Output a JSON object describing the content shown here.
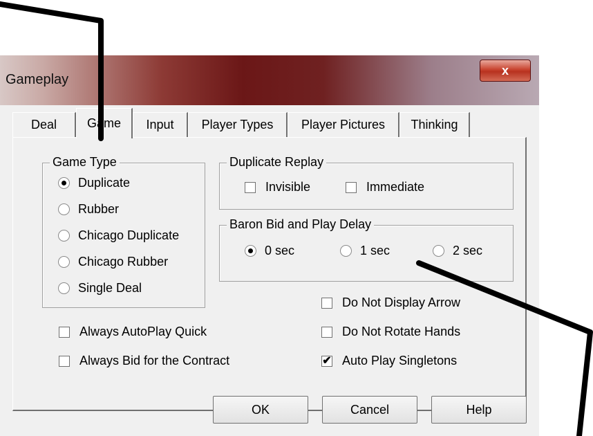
{
  "window": {
    "title": "Gameplay",
    "close_symbol": "x"
  },
  "tabs": [
    {
      "label": "Deal"
    },
    {
      "label": "Game",
      "active": true
    },
    {
      "label": "Input"
    },
    {
      "label": "Player Types"
    },
    {
      "label": "Player Pictures"
    },
    {
      "label": "Thinking"
    }
  ],
  "game_type": {
    "title": "Game Type",
    "options": [
      {
        "label": "Duplicate",
        "selected": true
      },
      {
        "label": "Rubber",
        "selected": false
      },
      {
        "label": "Chicago Duplicate",
        "selected": false
      },
      {
        "label": "Chicago Rubber",
        "selected": false
      },
      {
        "label": "Single Deal",
        "selected": false
      }
    ]
  },
  "duplicate_replay": {
    "title": "Duplicate Replay",
    "options": [
      {
        "label": "Invisible",
        "checked": false
      },
      {
        "label": "Immediate",
        "checked": false
      }
    ]
  },
  "baron_delay": {
    "title": "Baron Bid and Play Delay",
    "options": [
      {
        "label": "0 sec",
        "selected": true
      },
      {
        "label": "1 sec",
        "selected": false
      },
      {
        "label": "2 sec",
        "selected": false
      }
    ]
  },
  "checkboxes": {
    "always_autoplay_quick": {
      "label": "Always AutoPlay Quick",
      "checked": false
    },
    "always_bid_contract": {
      "label": "Always Bid for the Contract",
      "checked": false
    },
    "do_not_display_arrow": {
      "label": "Do Not Display Arrow",
      "checked": false
    },
    "do_not_rotate_hands": {
      "label": "Do Not  Rotate Hands",
      "checked": false
    },
    "auto_play_singletons": {
      "label": "Auto Play Singletons",
      "checked": true,
      "mark": "✔"
    }
  },
  "buttons": {
    "ok": "OK",
    "cancel": "Cancel",
    "help": "Help"
  },
  "colors": {
    "dialog_bg": "#f0f0f0",
    "titlebar_dark": "#6b1717",
    "close_red": "#c8432f",
    "annotation_line": "#000000"
  }
}
